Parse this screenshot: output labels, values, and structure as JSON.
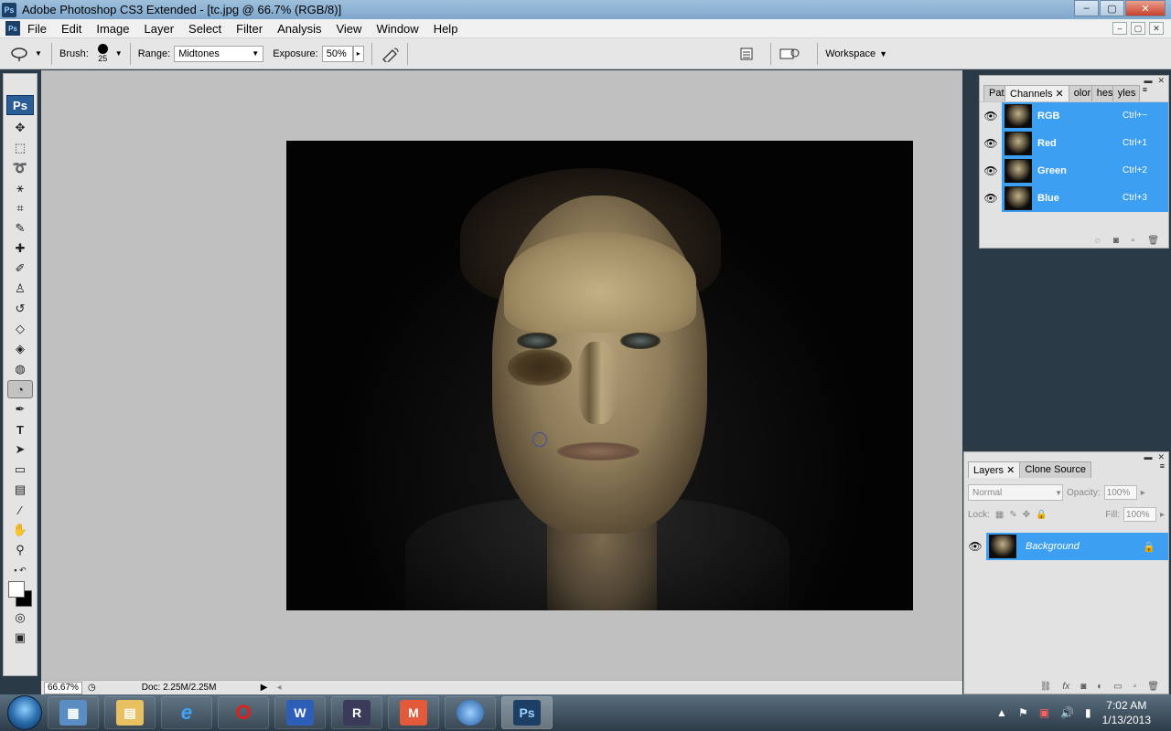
{
  "window": {
    "app_badge": "Ps",
    "title": "Adobe Photoshop CS3 Extended - [tc.jpg @ 66.7% (RGB/8)]",
    "buttons": {
      "minimize": "–",
      "maximize": "▢",
      "close": "✕"
    }
  },
  "menubar": {
    "items": [
      "File",
      "Edit",
      "Image",
      "Layer",
      "Select",
      "Filter",
      "Analysis",
      "View",
      "Window",
      "Help"
    ]
  },
  "options": {
    "brush_label": "Brush:",
    "brush_size": "25",
    "range_label": "Range:",
    "range_value": "Midtones",
    "exposure_label": "Exposure:",
    "exposure_value": "50%",
    "workspace_label": "Workspace"
  },
  "toolbox": {
    "logo": "Ps"
  },
  "statusbar": {
    "zoom": "66.67%",
    "doc": "Doc: 2.25M/2.25M"
  },
  "channels_panel": {
    "tabs": [
      "Pat",
      "Channels",
      "olor",
      "hes",
      "yles"
    ],
    "active_tab": "Channels",
    "channels": [
      {
        "name": "RGB",
        "shortcut": "Ctrl+~"
      },
      {
        "name": "Red",
        "shortcut": "Ctrl+1"
      },
      {
        "name": "Green",
        "shortcut": "Ctrl+2"
      },
      {
        "name": "Blue",
        "shortcut": "Ctrl+3"
      }
    ]
  },
  "layers_panel": {
    "tabs": [
      "Layers",
      "Clone Source"
    ],
    "blend_mode": "Normal",
    "opacity_label": "Opacity:",
    "opacity_value": "100%",
    "lock_label": "Lock:",
    "fill_label": "Fill:",
    "fill_value": "100%",
    "layers": [
      {
        "name": "Background"
      }
    ]
  },
  "taskbar": {
    "apps": [
      "explorer-icon",
      "file-manager-icon",
      "ie-icon",
      "opera-icon",
      "word-icon",
      "winrar-icon",
      "mail-icon",
      "google-earth-icon",
      "photoshop-icon"
    ],
    "active_app_label": "Ps",
    "word_label": "W",
    "opera_label": "O",
    "m_label": "M",
    "r_label": "R",
    "time": "7:02 AM",
    "date": "1/13/2013"
  }
}
